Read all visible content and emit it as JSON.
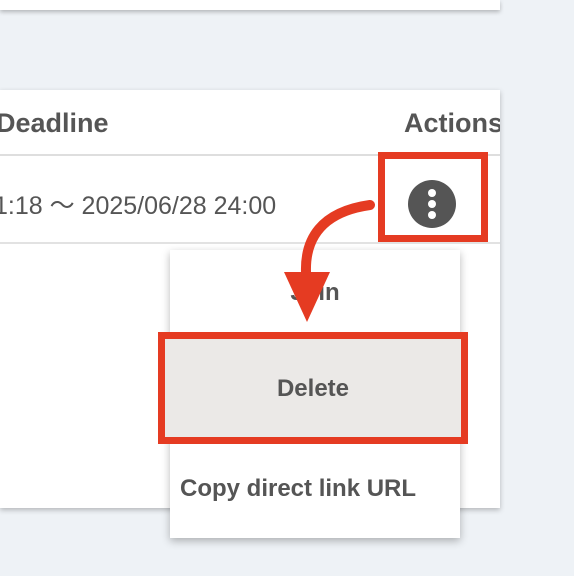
{
  "table": {
    "headers": {
      "deadline": "Deadline",
      "actions": "Actions"
    },
    "rows": [
      {
        "deadline": "1:18 ～ 2025/06/28 24:00"
      }
    ]
  },
  "menu_button": {
    "icon": "more-vertical-icon"
  },
  "dropdown": {
    "items": [
      {
        "label": "Join"
      },
      {
        "label": "Delete"
      },
      {
        "label": "Copy direct link URL"
      }
    ]
  },
  "annotation": {
    "highlight_color": "#e53b22"
  }
}
